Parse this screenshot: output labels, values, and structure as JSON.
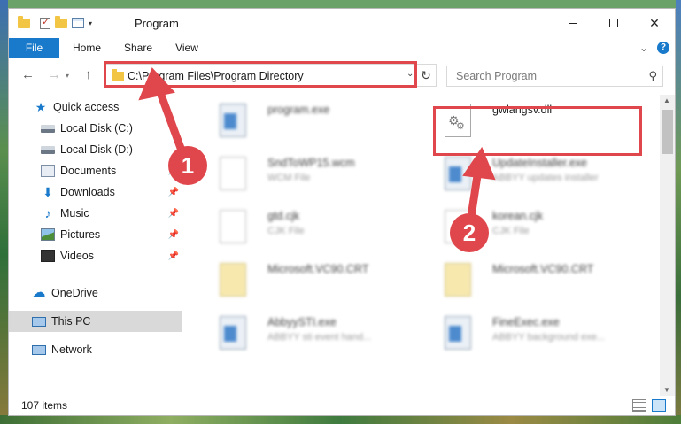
{
  "window": {
    "title": "Program",
    "item_count": "107 items"
  },
  "ribbon": {
    "tabs": [
      "File",
      "Home",
      "Share",
      "View"
    ],
    "help": "?"
  },
  "address": {
    "path": "C:\\Program Files\\Program Directory",
    "search_placeholder": "Search Program"
  },
  "sidebar": {
    "items": [
      {
        "label": "Quick access",
        "icon": "star-icon"
      },
      {
        "label": "Local Disk (C:)",
        "icon": "drive-icon"
      },
      {
        "label": "Local Disk (D:)",
        "icon": "drive-icon"
      },
      {
        "label": "Documents",
        "icon": "documents-icon"
      },
      {
        "label": "Downloads",
        "icon": "download-icon"
      },
      {
        "label": "Music",
        "icon": "music-icon"
      },
      {
        "label": "Pictures",
        "icon": "pictures-icon"
      },
      {
        "label": "Videos",
        "icon": "videos-icon"
      },
      {
        "label": "OneDrive",
        "icon": "cloud-icon"
      },
      {
        "label": "This PC",
        "icon": "computer-icon"
      },
      {
        "label": "Network",
        "icon": "network-icon"
      }
    ]
  },
  "files": [
    {
      "name": "program.exe",
      "desc": "",
      "icon": "exe-icon"
    },
    {
      "name": "gwlangsv.dll",
      "desc": "",
      "icon": "dll-icon"
    },
    {
      "name": "SndToWP15.wcm",
      "desc": "WCM File",
      "icon": "file-icon"
    },
    {
      "name": "UpdateInstaller.exe",
      "desc": "ABBYY updates installer",
      "icon": "exe-icon"
    },
    {
      "name": "gtd.cjk",
      "desc": "CJK File",
      "icon": "file-icon"
    },
    {
      "name": "korean.cjk",
      "desc": "CJK File",
      "icon": "file-icon"
    },
    {
      "name": "Microsoft.VC90.CRT",
      "desc": "",
      "icon": "folder-file-icon"
    },
    {
      "name": "Microsoft.VC90.CRT",
      "desc": "",
      "icon": "folder-file-icon"
    },
    {
      "name": "AbbyySTI.exe",
      "desc": "ABBYY sti event hand...",
      "icon": "exe-icon"
    },
    {
      "name": "FineExec.exe",
      "desc": "ABBYY background exe...",
      "icon": "exe-icon"
    }
  ],
  "annotations": {
    "step1": "1",
    "step2": "2",
    "color": "#e0474c"
  },
  "colors": {
    "accent": "#1979ca",
    "highlight": "#e0474c"
  }
}
